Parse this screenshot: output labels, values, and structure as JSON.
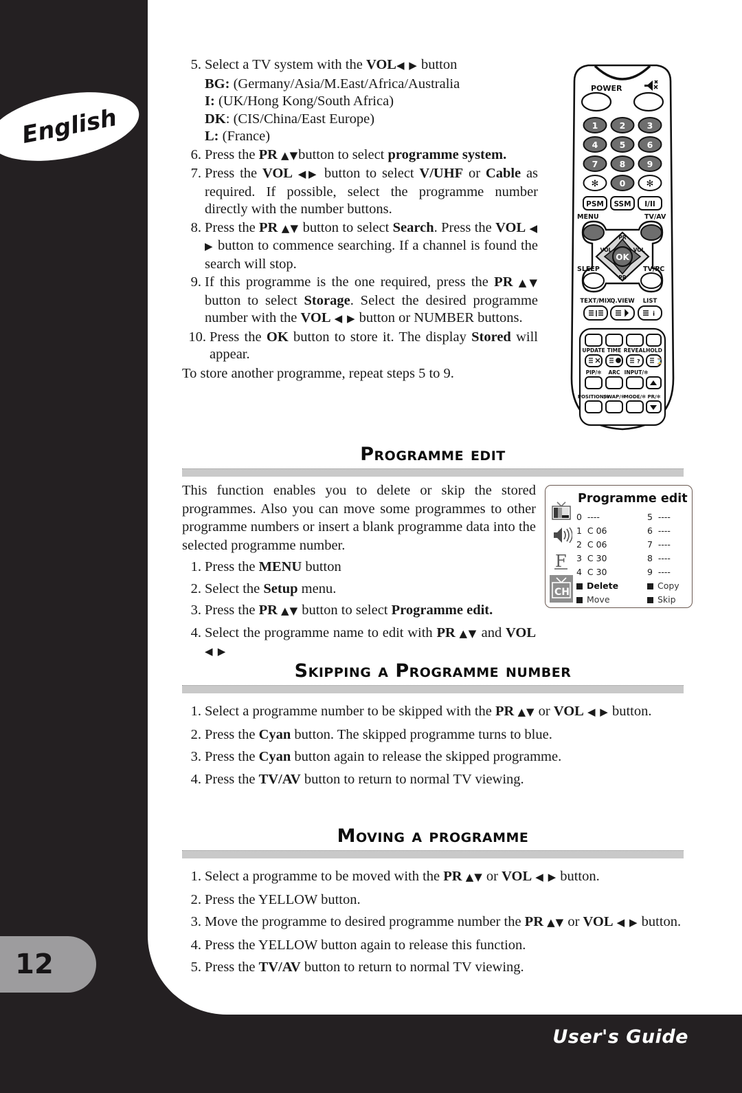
{
  "page": {
    "language_tab": "English",
    "page_number": "12",
    "footer": "User's Guide"
  },
  "top_steps": [
    {
      "num": "5.",
      "html": "Select a TV system with the <b>VOL</b><span class=\"ar\">◀ ▶</span> button"
    },
    {
      "num": "6.",
      "html": "Press the <b>PR <span class=\"ar\">▲▼</span></b>button to select <b>programme system.</b>"
    },
    {
      "num": "7.",
      "html": "Press the <b>VOL</b> <span class=\"ar\">◀▶</span> button to select <b>V/UHF</b> or <b>Cable</b> as required. If possible, select the programme number directly with the number buttons."
    },
    {
      "num": "8.",
      "html": "Press the <b>PR <span class=\"ar\">▲▼</span></b> button to select <b>Search</b>. Press the <b>VOL</b> <span class=\"ar\">◀ ▶</span> button to commence searching. If a channel is found the search will stop."
    },
    {
      "num": "9.",
      "html": "If this programme is the one required, press the <b>PR <span class=\"ar\">▲▼</span></b> button to select <b>Storage</b>. Select the desired programme number with the <b>VOL</b> <span class=\"ar\">◀ ▶</span> button or NUMBER buttons."
    },
    {
      "num": "10.",
      "html": "Press the <b>OK</b> button to store it. The display <b>Stored</b> will appear."
    }
  ],
  "tv_systems": [
    {
      "code": "BG:",
      "desc": "(Germany/Asia/M.East/Africa/Australia"
    },
    {
      "code": "I:",
      "desc": "(UK/Hong Kong/South Africa)"
    },
    {
      "code": "DK",
      "desc": ": (CIS/China/East Europe)"
    },
    {
      "code": "L:",
      "desc": "(France)"
    }
  ],
  "closing_note": "To store another programme, repeat steps 5 to 9.",
  "sections": [
    {
      "id": "programme-edit",
      "title": "Programme edit",
      "paragraph": "This function enables you to delete or skip the stored programmes. Also you can move some programmes to other programme numbers or insert a blank programme data into the selected programme number.",
      "steps": [
        {
          "num": "1.",
          "html": "Press the <b>MENU</b> button"
        },
        {
          "num": "2.",
          "html": "Select the <b>Setup</b> menu."
        },
        {
          "num": "3.",
          "html": "Press the <b>PR <span class=\"ar\">▲▼</span></b> button to select <b>Programme edit.</b>"
        },
        {
          "num": "4.",
          "html": "Select the programme name to edit with <b>PR <span class=\"ar\">▲▼</span></b> and <b>VOL <span class=\"ar\">◀ ▶</span></b>"
        }
      ]
    },
    {
      "id": "skipping-a-programme-number",
      "title": "Skipping a Programme number",
      "paragraph": "",
      "steps": [
        {
          "num": "1.",
          "html": "Select a programme number to be skipped with the <b>PR <span class=\"ar\">▲▼</span></b> or <b>VOL</b> <span class=\"ar\">◀ ▶</span> button."
        },
        {
          "num": "2.",
          "html": "Press the <b>Cyan</b> button. The skipped programme turns to blue."
        },
        {
          "num": "3.",
          "html": "Press the <b>Cyan</b> button again to release the skipped programme."
        },
        {
          "num": "4.",
          "html": "Press the <b>TV/AV</b> button to return to normal TV viewing."
        }
      ]
    },
    {
      "id": "moving-a-programme",
      "title": "Moving a programme",
      "paragraph": "",
      "steps": [
        {
          "num": "1.",
          "html": "Select a programme to be moved with the <b>PR <span class=\"ar\">▲▼</span></b> or <b>VOL</b> <span class=\"ar\">◀ ▶</span> button."
        },
        {
          "num": "2.",
          "html": "Press the YELLOW button."
        },
        {
          "num": "3.",
          "html": "Move the programme to desired programme number the <b>PR <span class=\"ar\">▲▼</span></b> or <b>VOL</b> <span class=\"ar\">◀ ▶</span> button."
        },
        {
          "num": "4.",
          "html": "Press the YELLOW button again to release this function."
        },
        {
          "num": "5.",
          "html": "Press the <b>TV/AV</b> button to return to normal TV viewing."
        }
      ]
    }
  ],
  "osd": {
    "title": "Programme edit",
    "left_column": [
      {
        "label": "0  ----",
        "selected": false
      },
      {
        "label": "1  C 06",
        "selected": true
      },
      {
        "label": "2  C 06",
        "selected": false
      },
      {
        "label": "3  C 30",
        "selected": false
      },
      {
        "label": "4  C 30",
        "selected": false
      }
    ],
    "right_column": [
      {
        "label": "5  ----",
        "selected": false
      },
      {
        "label": "6  ----",
        "selected": false
      },
      {
        "label": "7  ----",
        "selected": false
      },
      {
        "label": "8  ----",
        "selected": false
      },
      {
        "label": "9  ----",
        "selected": false
      }
    ],
    "actions": {
      "delete": "Delete",
      "move": "Move",
      "copy": "Copy",
      "skip": "Skip"
    },
    "icons": [
      "tv-picture-icon",
      "speaker-icon",
      "feature-f-icon",
      "channel-ch-icon"
    ],
    "colors": {
      "selected_bg": "#3d3d3d",
      "marker": "#1c1c1c",
      "border": "#6b5a52"
    }
  },
  "remote": {
    "power_label": "POWER",
    "mute_label": "mute-icon",
    "number_keys": [
      "1",
      "2",
      "3",
      "4",
      "5",
      "6",
      "7",
      "8",
      "9",
      "★",
      "0",
      "★"
    ],
    "mode_keys": [
      "PSM",
      "SSM",
      "I/II"
    ],
    "menu_label": "MENU",
    "tvav_label": "TV/AV",
    "sleep_label": "SLEEP",
    "tvpc_label": "TV/PC",
    "pr_up_label": "PR",
    "pr_down_label": "PR",
    "vol_left_label": "VOL",
    "vol_right_label": "VOL",
    "ok_label": "OK",
    "teletext_keys": [
      "TEXT/MIX",
      "Q.VIEW",
      "LIST"
    ],
    "pad_row1": [
      "UPDATE",
      "TIME",
      "REVEAL",
      "HOLD"
    ],
    "pad_row2": [
      "PIP/✻",
      "ARC",
      "INPUT/✻"
    ],
    "pad_row3": [
      "POSITION/✻",
      "SWAP/✻",
      "MODE/✻",
      "PR/✻"
    ],
    "colors": {
      "key_fill": "#6e6e6e",
      "body_stroke": "#111111"
    }
  },
  "theme": {
    "page_bg": "#242022",
    "sheet_bg": "#ffffff",
    "bar_gray": "#c9c9c9",
    "badge_gray": "#9d9c9e",
    "text": "#1a1a1a"
  }
}
